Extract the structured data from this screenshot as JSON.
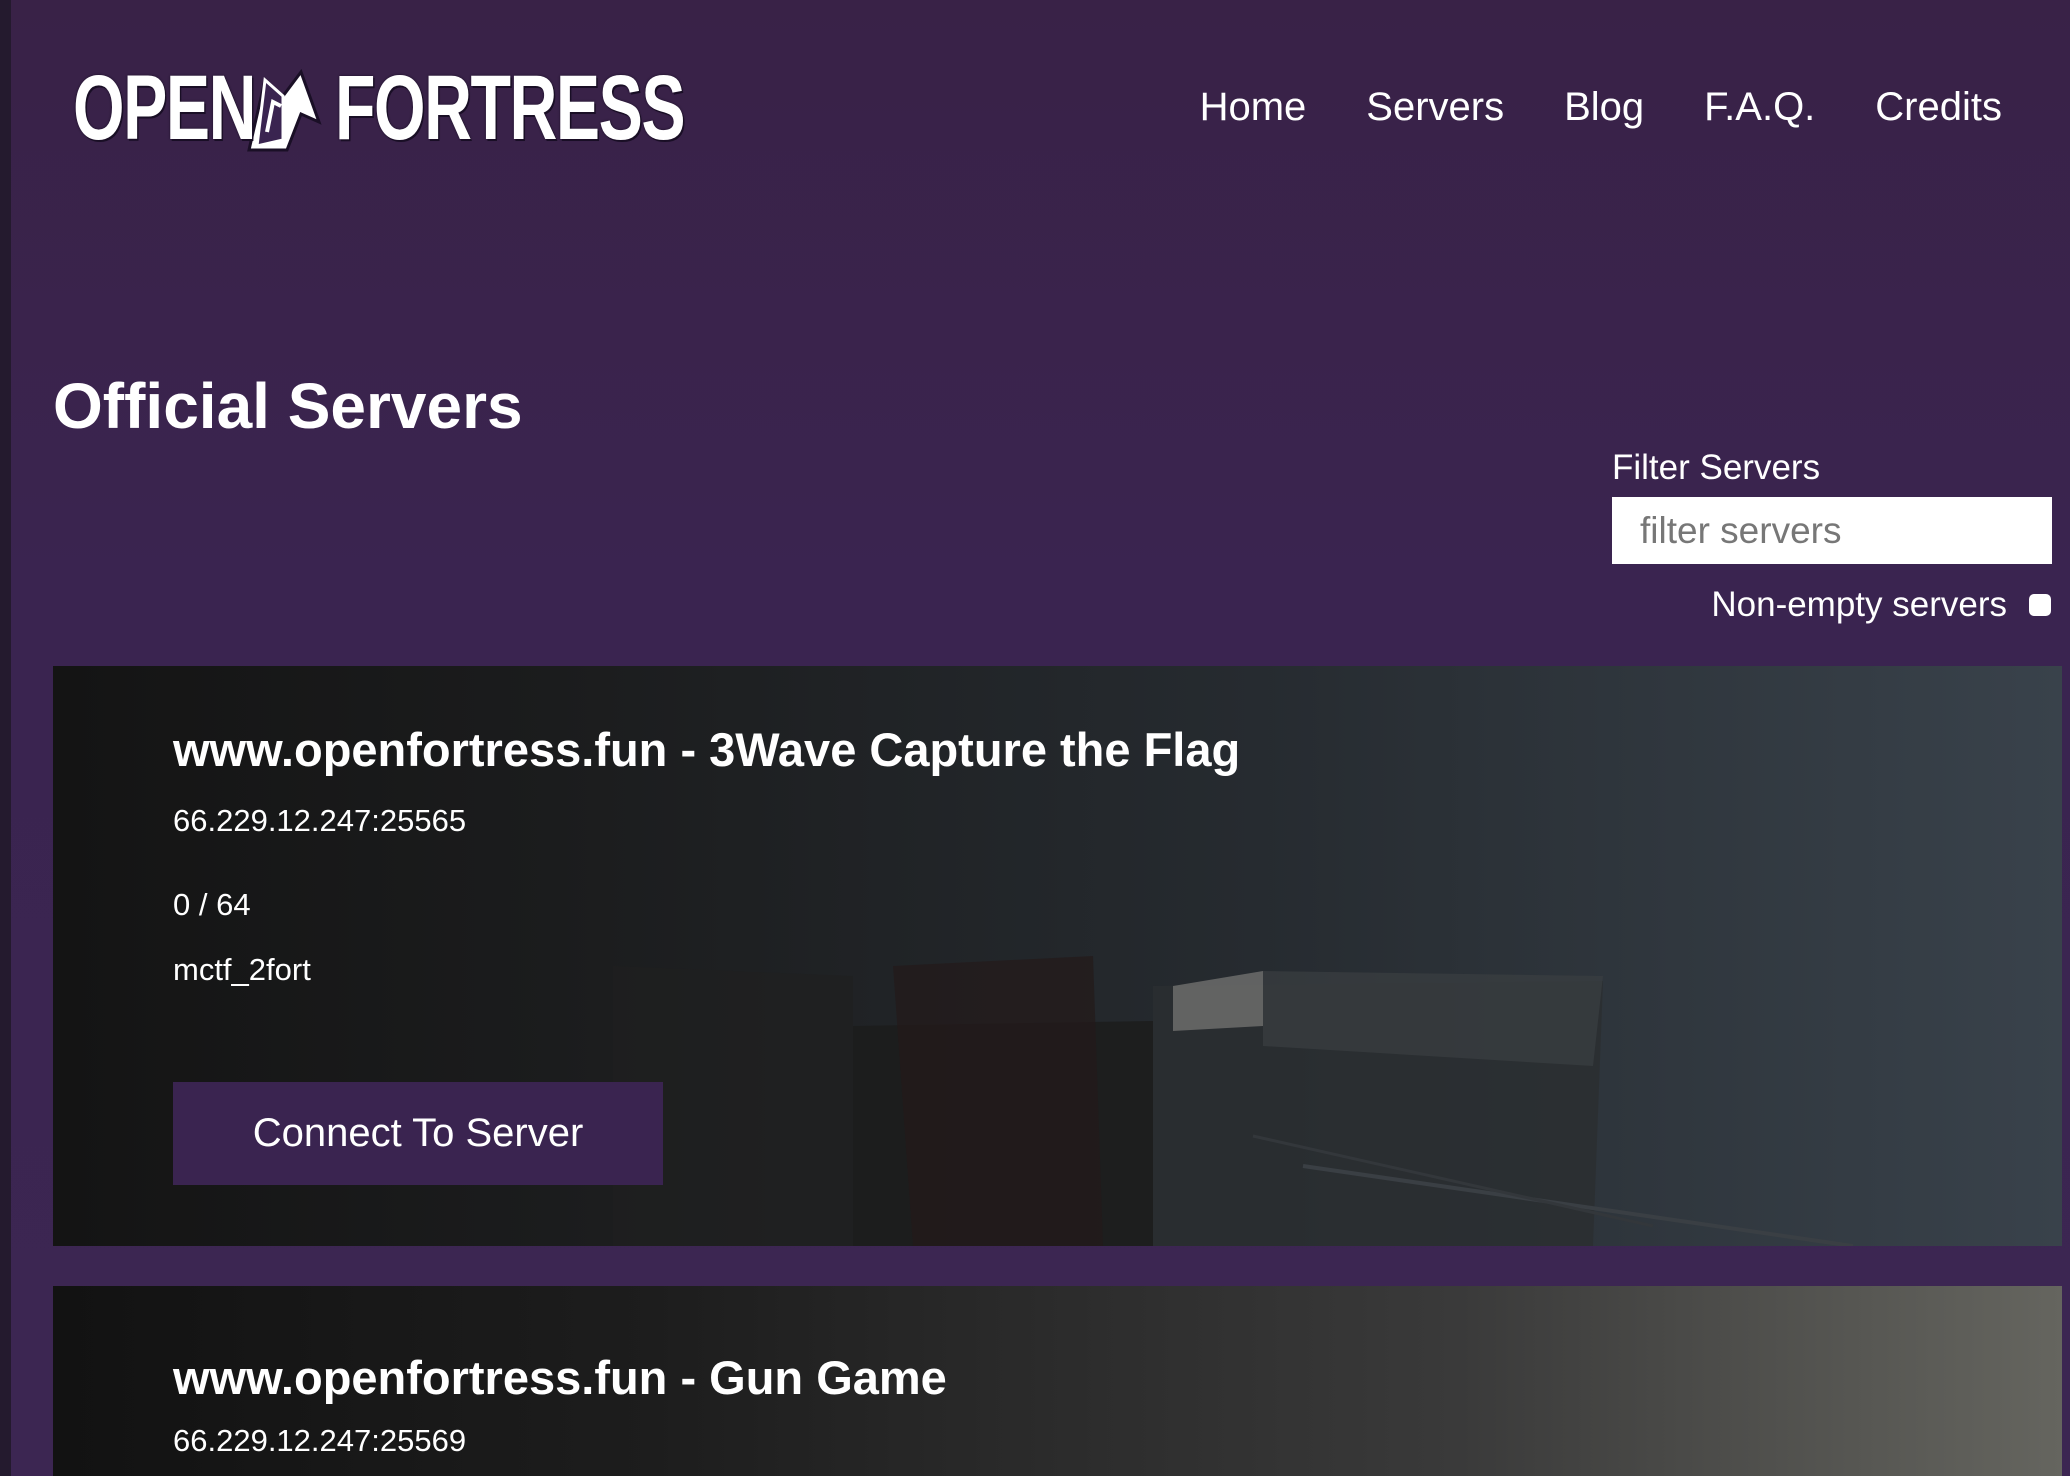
{
  "header": {
    "logo": {
      "word_left": "OPEN",
      "word_right": "FORTRESS"
    },
    "nav": [
      {
        "label": "Home"
      },
      {
        "label": "Servers"
      },
      {
        "label": "Blog"
      },
      {
        "label": "F.A.Q."
      },
      {
        "label": "Credits"
      }
    ]
  },
  "main": {
    "title": "Official Servers",
    "filter": {
      "label": "Filter Servers",
      "placeholder": "filter servers",
      "value": "",
      "nonempty_label": "Non-empty servers",
      "nonempty_checked": false
    },
    "servers": [
      {
        "name": "www.openfortress.fun - 3Wave Capture the Flag",
        "address": "66.229.12.247:25565",
        "players": "0 / 64",
        "map": "mctf_2fort",
        "connect_label": "Connect To Server"
      },
      {
        "name": "www.openfortress.fun - Gun Game",
        "address": "66.229.12.247:25569"
      }
    ]
  },
  "colors": {
    "background": "#3a2450",
    "button": "#3a2450",
    "text": "#ffffff"
  }
}
